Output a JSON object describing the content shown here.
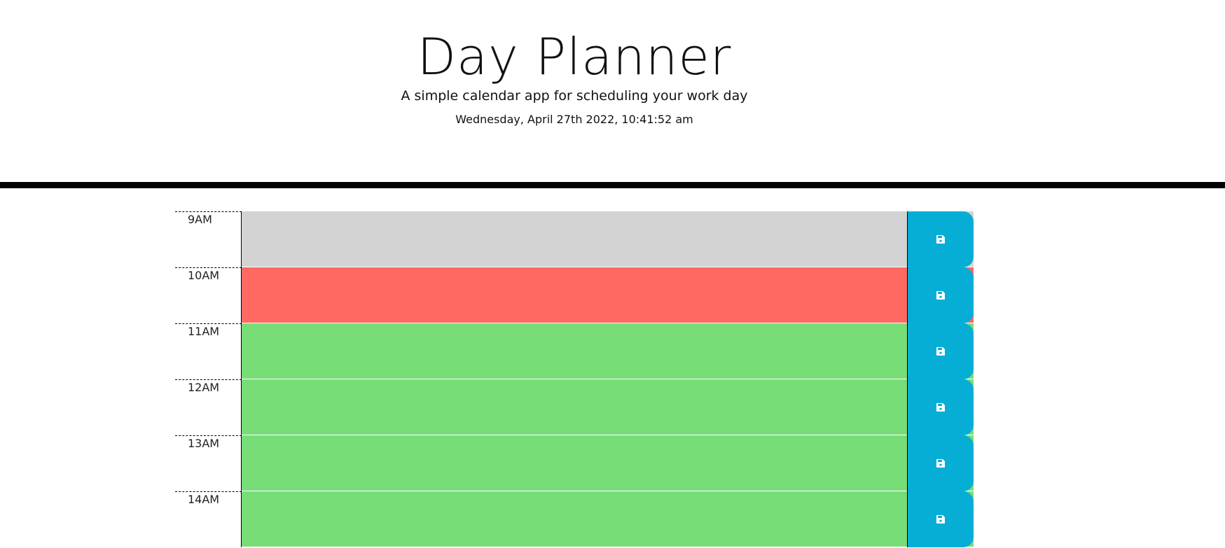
{
  "header": {
    "title": "Day Planner",
    "lead": "A simple calendar app for scheduling your work day",
    "current_datetime": "Wednesday, April 27th 2022, 10:41:52 am"
  },
  "colors": {
    "past": "#d3d3d3",
    "present": "#ff6961",
    "future": "#77dd77",
    "save_button": "#06aed5",
    "divider": "#000000"
  },
  "save_icon": "save-icon",
  "time_blocks": [
    {
      "hour": "9AM",
      "state": "past",
      "text": ""
    },
    {
      "hour": "10AM",
      "state": "present",
      "text": ""
    },
    {
      "hour": "11AM",
      "state": "future",
      "text": ""
    },
    {
      "hour": "12AM",
      "state": "future",
      "text": ""
    },
    {
      "hour": "13AM",
      "state": "future",
      "text": ""
    },
    {
      "hour": "14AM",
      "state": "future",
      "text": ""
    }
  ]
}
